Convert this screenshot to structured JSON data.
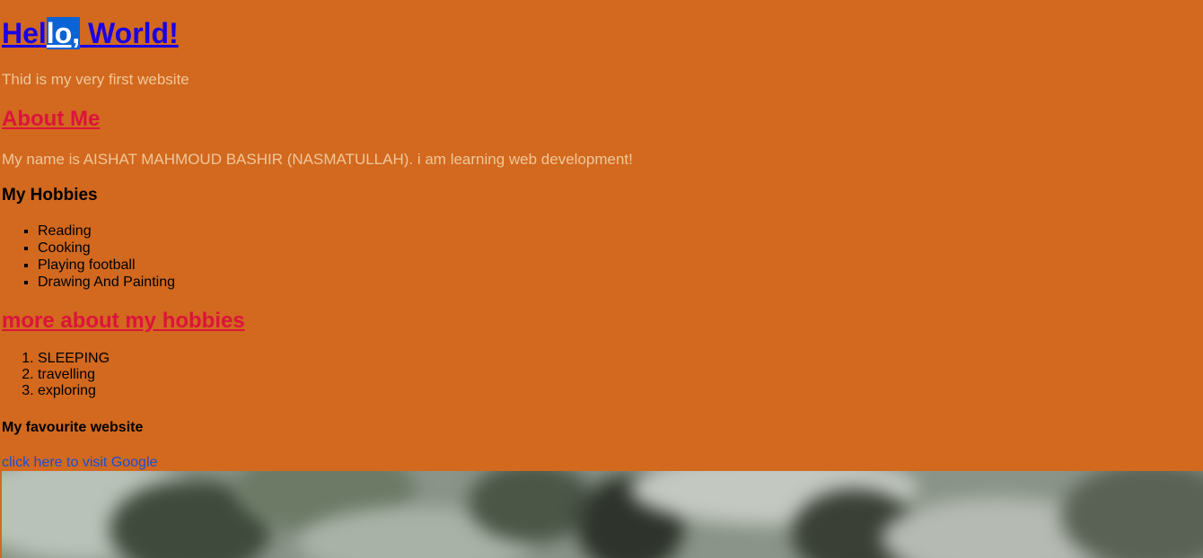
{
  "heading": {
    "part1": "Hel",
    "highlighted": "lo,",
    "part2": " World!"
  },
  "intro": "Thid is my very first website",
  "about": {
    "title": "About Me",
    "text": "My name is AISHAT MAHMOUD BASHIR (NASMATULLAH). i am learning web development!"
  },
  "hobbies": {
    "title": "My Hobbies",
    "items": [
      "Reading",
      "Cooking",
      "Playing football",
      "Drawing And Painting"
    ]
  },
  "more_hobbies": {
    "title": "more about my hobbies",
    "items": [
      "SLEEPING",
      "travelling",
      "exploring"
    ]
  },
  "favourite": {
    "title": "My favourite website",
    "link_text": "click here to visit Google"
  },
  "colors": {
    "background": "#d2691e",
    "heading": "#1a00e6",
    "subheading": "#dc143c",
    "body_text": "#f0c79a",
    "link": "#1a4fd6"
  }
}
